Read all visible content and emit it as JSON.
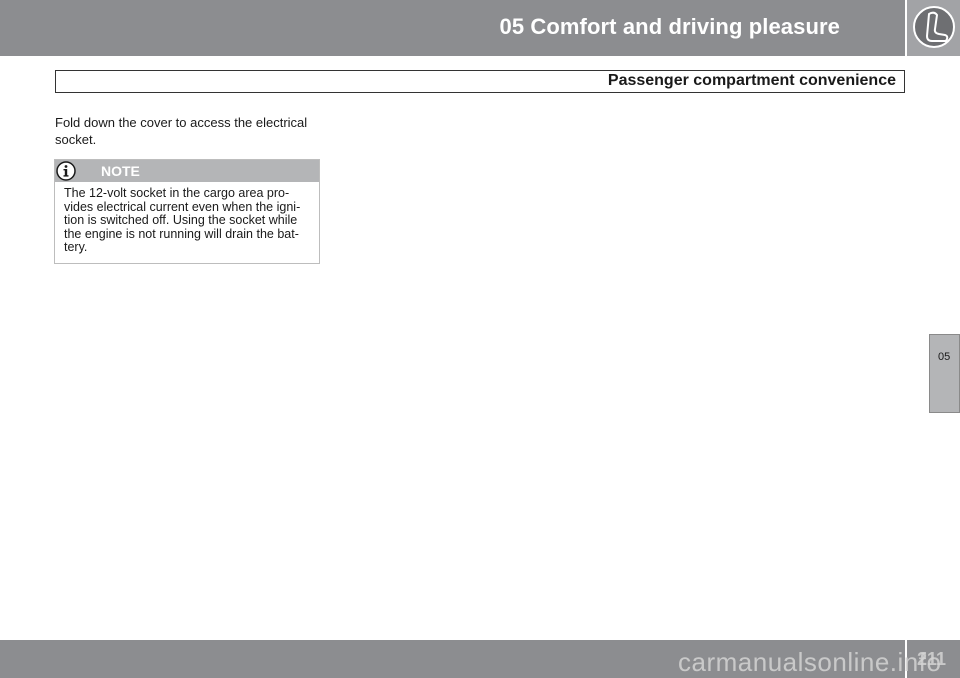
{
  "header": {
    "chapter_title": "05 Comfort and driving pleasure",
    "icon": "seat-icon"
  },
  "section": {
    "title": "Passenger compartment convenience"
  },
  "content": {
    "intro": "Fold down the cover to access the electrical socket."
  },
  "note": {
    "icon": "info-icon",
    "label": "NOTE",
    "text": "The 12-volt socket in the cargo area pro-\nvides electrical current even when the igni-\ntion is switched off. Using the socket while\nthe engine is not running will drain the bat-\ntery."
  },
  "side_tab": {
    "label": "05"
  },
  "footer": {
    "page_number": "211",
    "watermark": "carmanualsonline.info"
  },
  "colors": {
    "header_gray": "#8c8d90",
    "note_header_gray": "#b4b5b7",
    "tab_gray": "#b4b5b7"
  }
}
